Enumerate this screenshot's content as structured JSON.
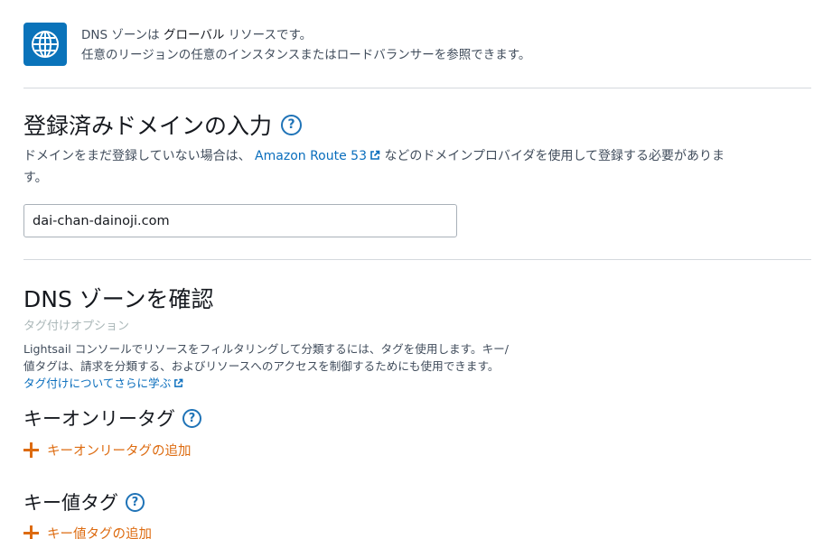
{
  "info": {
    "line1_prefix": "DNS ゾーンは",
    "line1_emphasis": "グローバル",
    "line1_suffix": "リソースです。",
    "line2": "任意のリージョンの任意のインスタンスまたはロードバランサーを参照できます。",
    "icon": "globe-icon"
  },
  "domain_section": {
    "title": "登録済みドメインの入力",
    "help_icon": "?",
    "desc_prefix": "ドメインをまだ登録していない場合は、",
    "desc_link": "Amazon Route 53",
    "desc_suffix": "などのドメインプロバイダを使用して登録する必要がありま",
    "desc_line2": "す。",
    "input_value": "dai-chan-dainoji.com"
  },
  "dns_section": {
    "title": "DNS ゾーンを確認",
    "tag_caption": "タグ付けオプション",
    "tag_desc_line1": "Lightsail コンソールでリソースをフィルタリングして分類するには、タグを使用します。キー/",
    "tag_desc_line2": "値タグは、請求を分類する、およびリソースへのアクセスを制御するためにも使用できます。",
    "tag_learn_link": "タグ付けについてさらに学ぶ"
  },
  "key_only": {
    "title": "キーオンリータグ",
    "help_icon": "?",
    "add_label": "キーオンリータグの追加"
  },
  "key_value": {
    "title": "キー値タグ",
    "help_icon": "?",
    "add_label": "キー値タグの追加"
  },
  "colors": {
    "accent_blue": "#0a73ba",
    "link_blue": "#0a6ebd",
    "add_orange": "#dd6b10"
  }
}
